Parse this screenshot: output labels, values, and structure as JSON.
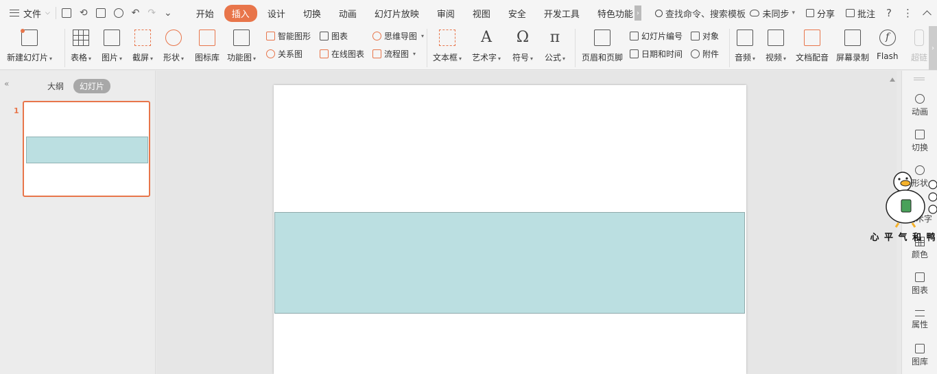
{
  "menubar": {
    "file_label": "文件",
    "tabs": [
      "开始",
      "插入",
      "设计",
      "切换",
      "动画",
      "幻灯片放映",
      "审阅",
      "视图",
      "安全",
      "开发工具",
      "特色功能"
    ],
    "active_tab": "插入",
    "search_label": "查找命令、搜索模板",
    "sync_label": "未同步",
    "share_label": "分享",
    "comment_label": "批注"
  },
  "ribbon": {
    "new_slide": "新建幻灯片",
    "table": "表格",
    "picture": "图片",
    "screenshot": "截屏",
    "shape": "形状",
    "icon_lib": "图标库",
    "func_chart": "功能图",
    "smart_shape": "智能图形",
    "chart": "图表",
    "mind_map": "思维导图",
    "relation": "关系图",
    "online_chart": "在线图表",
    "flowchart": "流程图",
    "textbox": "文本框",
    "wordart": "艺术字",
    "symbol": "符号",
    "formula": "公式",
    "header_footer": "页眉和页脚",
    "slide_number": "幻灯片编号",
    "object": "对象",
    "datetime": "日期和时间",
    "attachment": "附件",
    "audio": "音频",
    "video": "视频",
    "doc_voice": "文档配音",
    "screen_record": "屏幕录制",
    "flash": "Flash",
    "hyperlink": "超链"
  },
  "left_panel": {
    "outline_tab": "大纲",
    "slides_tab": "幻灯片",
    "slide_number": "1"
  },
  "right_pane": {
    "items": [
      "动画",
      "切换",
      "形状",
      "艺术字",
      "颜色",
      "图表",
      "属性",
      "图库"
    ]
  },
  "watermark": {
    "chars": [
      "心",
      "平",
      "气",
      "和",
      "鸭"
    ]
  },
  "colors": {
    "accent": "#e8754a",
    "band_fill": "#bbdfe1"
  }
}
